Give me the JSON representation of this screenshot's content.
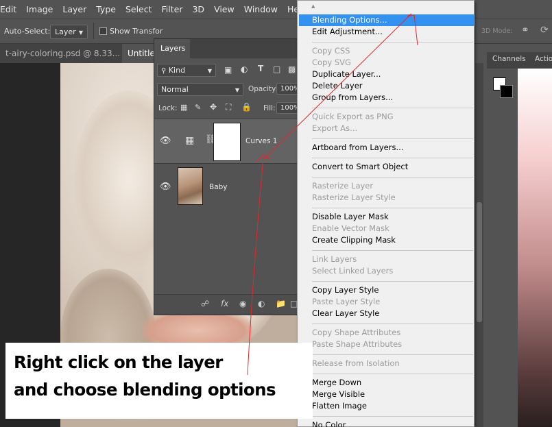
{
  "menubar": {
    "items": [
      "Edit",
      "Image",
      "Layer",
      "Type",
      "Select",
      "Filter",
      "3D",
      "View",
      "Window",
      "Help"
    ]
  },
  "options_bar": {
    "auto_select_label": "Auto-Select:",
    "auto_select_value": "Layer",
    "show_transform_label": "Show Transfor",
    "mode_3d_label": "3D Mode:"
  },
  "doc_tabs": {
    "inactive": "t-airy-coloring.psd @ 8.33...",
    "active": "Untitle"
  },
  "right_panel": {
    "tab_channels": "Channels",
    "tab_actions": "Actio"
  },
  "layers_panel": {
    "tab_label": "Layers",
    "kind_filter": "Kind",
    "blend_mode": "Normal",
    "opacity_label": "Opacity:",
    "opacity_value": "100%",
    "lock_label": "Lock:",
    "fill_label": "Fill:",
    "fill_value": "100%",
    "layers": [
      {
        "name": "Curves 1",
        "selected": true
      },
      {
        "name": "Baby",
        "selected": false
      }
    ]
  },
  "context_menu": {
    "groups": [
      [
        {
          "label": "Blending Options...",
          "enabled": true,
          "highlighted": true
        },
        {
          "label": "Edit Adjustment...",
          "enabled": true
        }
      ],
      [
        {
          "label": "Copy CSS",
          "enabled": false
        },
        {
          "label": "Copy SVG",
          "enabled": false
        },
        {
          "label": "Duplicate Layer...",
          "enabled": true
        },
        {
          "label": "Delete Layer",
          "enabled": true
        },
        {
          "label": "Group from Layers...",
          "enabled": true
        }
      ],
      [
        {
          "label": "Quick Export as PNG",
          "enabled": false
        },
        {
          "label": "Export As...",
          "enabled": false
        }
      ],
      [
        {
          "label": "Artboard from Layers...",
          "enabled": true
        }
      ],
      [
        {
          "label": "Convert to Smart Object",
          "enabled": true
        }
      ],
      [
        {
          "label": "Rasterize Layer",
          "enabled": false
        },
        {
          "label": "Rasterize Layer Style",
          "enabled": false
        }
      ],
      [
        {
          "label": "Disable Layer Mask",
          "enabled": true
        },
        {
          "label": "Enable Vector Mask",
          "enabled": false
        },
        {
          "label": "Create Clipping Mask",
          "enabled": true
        }
      ],
      [
        {
          "label": "Link Layers",
          "enabled": false
        },
        {
          "label": "Select Linked Layers",
          "enabled": false
        }
      ],
      [
        {
          "label": "Copy Layer Style",
          "enabled": true
        },
        {
          "label": "Paste Layer Style",
          "enabled": false
        },
        {
          "label": "Clear Layer Style",
          "enabled": true
        }
      ],
      [
        {
          "label": "Copy Shape Attributes",
          "enabled": false
        },
        {
          "label": "Paste Shape Attributes",
          "enabled": false
        }
      ],
      [
        {
          "label": "Release from Isolation",
          "enabled": false
        }
      ],
      [
        {
          "label": "Merge Down",
          "enabled": true
        },
        {
          "label": "Merge Visible",
          "enabled": true
        },
        {
          "label": "Flatten Image",
          "enabled": true
        }
      ],
      [
        {
          "label": "No Color",
          "enabled": true
        }
      ]
    ]
  },
  "caption": {
    "line1": "Right click on the layer",
    "line2": "and choose blending options"
  },
  "colors": {
    "annotation": "#e8262b",
    "menu_highlight": "#3392ef"
  }
}
